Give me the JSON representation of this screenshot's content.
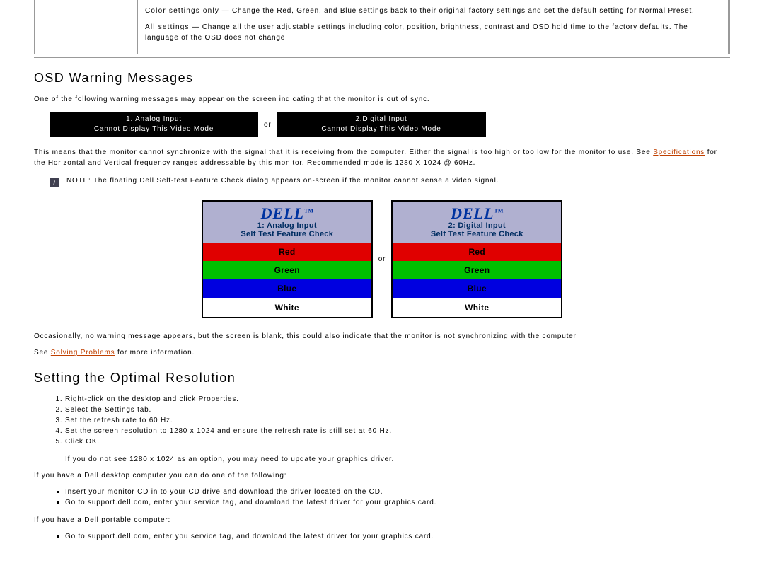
{
  "top_settings": {
    "row1": {
      "name": "Color settings only",
      "sep": " — ",
      "desc": "Change the Red, Green, and Blue settings back to their original factory settings and set  the default setting for  Normal Preset."
    },
    "row2": {
      "name": "All settings",
      "sep": " — ",
      "desc": " Change all the  user adjustable settings including color, position, brightness, contrast and OSD hold time  to the factory defaults. The language of the OSD does not change."
    }
  },
  "osd_heading": "OSD Warning Messages",
  "osd_intro": "One of the following  warning messages may appear on the screen indicating that the monitor is out of sync.",
  "boxes": {
    "left": {
      "l1": "1. Analog Input",
      "l2": "Cannot Display This Video Mode"
    },
    "or": "or",
    "right": {
      "l1": "2.Digital Input",
      "l2": "Cannot Display This Video Mode"
    }
  },
  "sync_para_pre": "This means that the monitor cannot synchronize with the signal that it is receiving from the computer. Either the signal is too high or too low for the monitor to use.  See ",
  "sync_link": "Specifications",
  "sync_para_post": " for the Horizontal and Vertical frequency ranges addressable by this monitor. Recommended mode is 1280 X 1024 @ 60Hz.",
  "note": "NOTE: The floating Dell Self-test Feature Check dialog  appears on-screen if the monitor cannot sense a video signal.",
  "selftest": {
    "logo": "DELL",
    "tm": "TM",
    "left_title1": "1: Analog Input",
    "right_title1": "2: Digital Input",
    "title2": "Self Test  Feature Check",
    "red": "Red",
    "green": "Green",
    "blue": "Blue",
    "white": "White",
    "or": "or"
  },
  "occasionally": "Occasionally, no warning message appears, but the screen is blank,  this could also indicate that the monitor is not synchronizing with the computer.",
  "see_pre": "See ",
  "see_link": "Solving Problems",
  "see_post": " for more information.",
  "res_heading": "Setting the Optimal Resolution",
  "steps": {
    "s1": "Right-click on the desktop and click Properties.",
    "s2": "Select the Settings tab.",
    "s3": "Set the refresh rate to 60 Hz.",
    "s4": "Set the screen resolution to 1280 x 1024 and ensure the refresh rate is still set at 60 Hz.",
    "s5": "Click OK."
  },
  "res_note": "If you do not see 1280 x 1024 as an option, you may need to update your graphics driver.",
  "desktop_intro": "If you have a Dell desktop computer you can do one of the following:",
  "desktop_bullets": {
    "b1": "Insert your monitor CD in to your CD drive and download the driver located on the CD.",
    "b2": "Go to support.dell.com, enter  your service tag, and download the latest driver for your graphics card."
  },
  "portable_intro": "If you have a Dell portable computer:",
  "portable_bullets": {
    "b1": "Go to support.dell.com, enter you service tag, and download the latest driver for your graphics card."
  }
}
